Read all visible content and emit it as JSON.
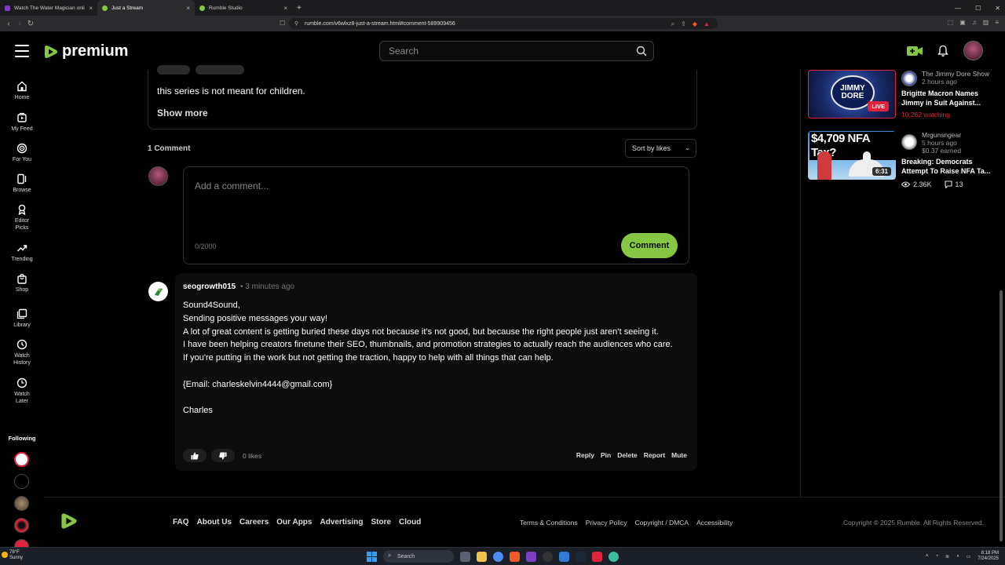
{
  "browser": {
    "tabs": [
      {
        "title": "Watch The Water Magician online fr...",
        "active": false,
        "favicon_color": "#7b3fbf"
      },
      {
        "title": "Just a Stream",
        "active": true,
        "favicon_color": "#85c742"
      },
      {
        "title": "Rumble Studio",
        "active": false,
        "favicon_color": "#85c742"
      }
    ],
    "url": "rumble.com/v6wlxz8-just-a-stream.html#comment-589909456"
  },
  "header": {
    "logo_text": "premium",
    "search_placeholder": "Search"
  },
  "sidebar": {
    "items": [
      {
        "label": "Home",
        "icon": "home-icon"
      },
      {
        "label": "My Feed",
        "icon": "feed-icon"
      },
      {
        "label": "For You",
        "icon": "target-icon"
      },
      {
        "label": "Browse",
        "icon": "browse-icon"
      },
      {
        "label": "Editor Picks",
        "icon": "ribbon-icon"
      },
      {
        "label": "Trending",
        "icon": "trending-icon"
      },
      {
        "label": "Shop",
        "icon": "shop-icon"
      },
      {
        "label": "Library",
        "icon": "library-icon"
      },
      {
        "label": "Watch History",
        "icon": "history-icon"
      },
      {
        "label": "Watch Later",
        "icon": "clock-icon"
      }
    ],
    "following_label": "Following"
  },
  "description": {
    "text": "this series is not meant for children.",
    "show_more": "Show more"
  },
  "comments": {
    "count_label": "1 Comment",
    "sort_label": "Sort by likes",
    "input_placeholder": "Add a comment...",
    "char_count": "0/2000",
    "submit_label": "Comment",
    "items": [
      {
        "author": "seogrowth015",
        "time": "• 3 minutes ago",
        "body": "Sound4Sound,\nSending positive messages your way!\nA lot of great content is getting buried these days not because it’s not good, but because the right people just aren’t seeing it.\nI have been helping creators finetune their SEO, thumbnails, and promotion strategies to actually reach the audiences who care.\nIf you're putting in the work but not getting the traction, happy to help with all things that can help.\n\n{Email: charleskelvin4444@gmail.com}\n\nCharles",
        "likes": "0 likes",
        "actions": [
          "Reply",
          "Pin",
          "Delete",
          "Report",
          "Mute"
        ]
      }
    ]
  },
  "related": [
    {
      "thumb_text": "JIMMY DORE",
      "thumb_badge": "LIVE",
      "channel": "The Jimmy Dore Show",
      "meta": "2 hours ago",
      "title": "Brigitte Macron Names Jimmy in Suit Against...",
      "stat": "10,262 watching"
    },
    {
      "thumb_text": "$4,709 NFA Tax?",
      "thumb_badge": "6:31",
      "channel": "Mrgunsngear",
      "meta": "5 hours ago",
      "meta2": "$0.37 earned",
      "title": "Breaking: Democrats Attempt To Raise NFA Ta...",
      "views": "2.36K",
      "comments": "13"
    }
  ],
  "footer": {
    "links": [
      "FAQ",
      "About Us",
      "Careers",
      "Our Apps",
      "Advertising",
      "Store",
      "Cloud"
    ],
    "legal_links": [
      "Terms & Conditions",
      "Privacy Policy",
      "Copyright / DMCA",
      "Accessibility"
    ],
    "copyright": "Copyright © 2025 Rumble. All Rights Reserved."
  },
  "taskbar": {
    "weather_temp": "78°F",
    "weather_desc": "Sunny",
    "search_label": "Search",
    "time": "8:18 PM",
    "date": "7/24/2025"
  },
  "colors": {
    "brand_green": "#85c742",
    "live_red": "#e0243b"
  }
}
